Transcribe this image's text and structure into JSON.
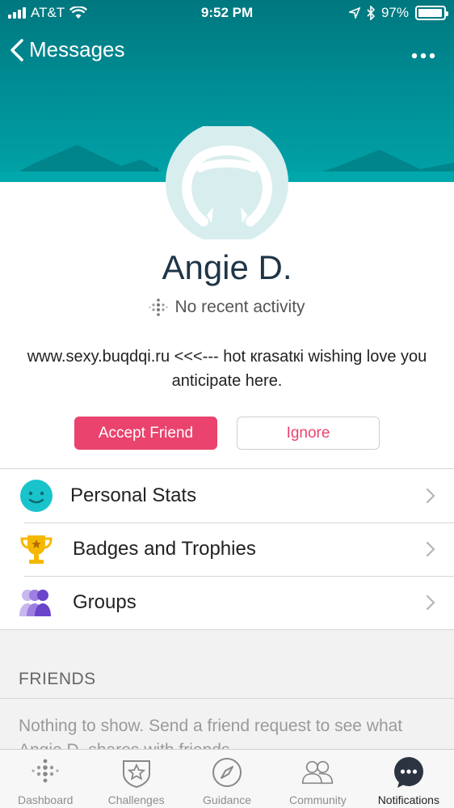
{
  "status_bar": {
    "carrier": "AT&T",
    "time": "9:52 PM",
    "battery": "97%",
    "battery_level": 0.97
  },
  "nav": {
    "back_label": "Messages",
    "more_icon": "ellipsis-icon"
  },
  "profile": {
    "name": "Angie D.",
    "activity": "No recent activity",
    "bio": "www.sexy.buqdqi.ru <<<--- hot кrasatкi wishing love you anticipate here."
  },
  "actions": {
    "accept_label": "Accept Friend",
    "ignore_label": "Ignore"
  },
  "menu": {
    "items": [
      {
        "label": "Personal Stats",
        "icon": "smiley-face-icon"
      },
      {
        "label": "Badges and Trophies",
        "icon": "trophy-icon"
      },
      {
        "label": "Groups",
        "icon": "people-group-icon"
      }
    ]
  },
  "friends": {
    "header": "FRIENDS",
    "empty_text": "Nothing to show. Send a friend request to see what Angie D. shares with friends."
  },
  "tabs": [
    {
      "label": "Dashboard",
      "icon": "dots-grid-icon"
    },
    {
      "label": "Challenges",
      "icon": "star-shield-icon"
    },
    {
      "label": "Guidance",
      "icon": "compass-icon"
    },
    {
      "label": "Community",
      "icon": "people-icon"
    },
    {
      "label": "Notifications",
      "icon": "chat-bubble-icon"
    }
  ],
  "colors": {
    "header_teal": "#008c93",
    "accent_pink": "#e9436e",
    "avatar_ring": "#d8eeee"
  }
}
